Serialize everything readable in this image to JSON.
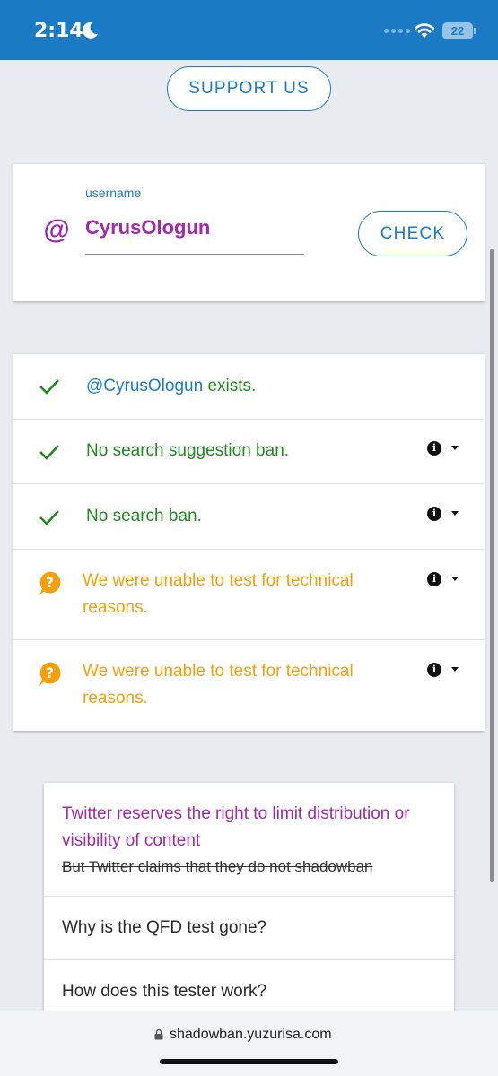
{
  "status_bar": {
    "time": "2:14",
    "battery": "22",
    "icons": [
      "moon-icon",
      "signal-icon",
      "wifi-icon",
      "battery-icon"
    ]
  },
  "support_button": "SUPPORT US",
  "search": {
    "label": "username",
    "value": "CyrusOlogun",
    "at_symbol": "@",
    "check_button": "CHECK"
  },
  "results": [
    {
      "icon": "check-icon",
      "status": "success",
      "handle": "@CyrusOlogun",
      "text": " exists."
    },
    {
      "icon": "check-icon",
      "status": "success",
      "text": "No search suggestion ban."
    },
    {
      "icon": "check-icon",
      "status": "success",
      "text": "No search ban."
    },
    {
      "icon": "question-icon",
      "status": "unknown",
      "text": "We were unable to test for technical reasons."
    },
    {
      "icon": "question-icon",
      "status": "unknown",
      "text": "We were unable to test for technical reasons."
    }
  ],
  "faq": {
    "headline": "Twitter reserves the right to limit distribution or visibility of content",
    "struck_line": "But Twitter claims that they do not shadowban",
    "items": [
      "Why is the QFD test gone?",
      "How does this tester work?"
    ]
  },
  "browser": {
    "url": "shadowban.yuzurisa.com"
  },
  "colors": {
    "accent_blue": "#1a7ac4",
    "success_green": "#1f8a1f",
    "warning_orange": "#f5a00a",
    "purple": "#a02aa8"
  }
}
